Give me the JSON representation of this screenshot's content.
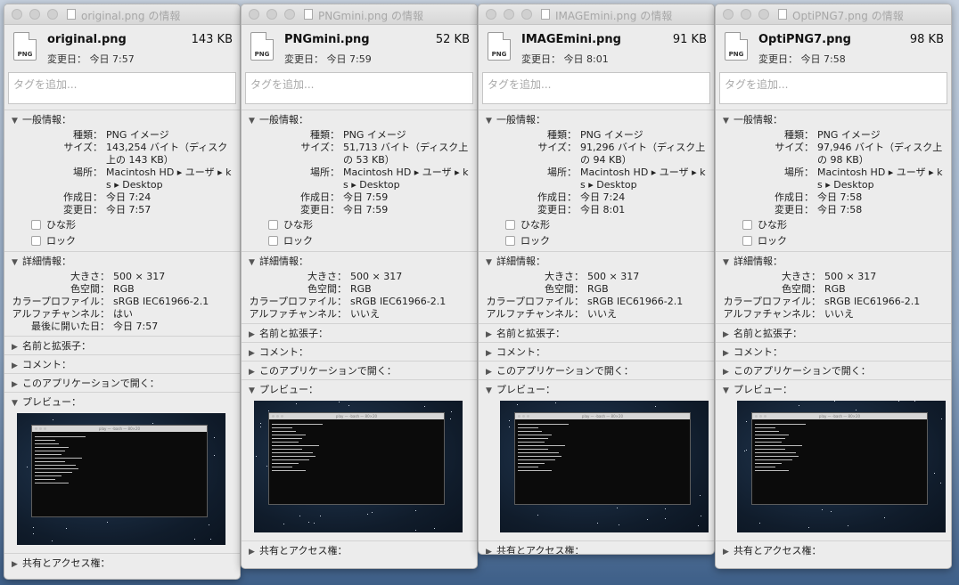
{
  "labels": {
    "tag_placeholder": "タグを追加...",
    "modified_prefix": "変更日：",
    "general": "一般情報：",
    "kind": "種類：",
    "size": "サイズ：",
    "where": "場所：",
    "created": "作成日：",
    "modified": "変更日：",
    "stationery": "ひな形",
    "locked": "ロック",
    "more_info": "詳細情報：",
    "dimensions": "大きさ：",
    "color_space": "色空間：",
    "color_profile": "カラープロファイル：",
    "alpha": "アルファチャンネル：",
    "last_opened": "最後に開いた日：",
    "name_ext": "名前と拡張子：",
    "comments": "コメント：",
    "open_with": "このアプリケーションで開く：",
    "preview": "プレビュー：",
    "sharing": "共有とアクセス権：",
    "icon_text": "PNG",
    "terminal_title": "play — -bash — 80×20"
  },
  "windows": [
    {
      "title": "original.png の情報",
      "name": "original.png",
      "size_short": "143 KB",
      "modified_short": "今日 7:57",
      "kind": "PNG イメージ",
      "size_long": "143,254 バイト（ディスク上の 143 KB）",
      "where": "Macintosh HD ▸ ユーザ ▸ ks ▸ Desktop",
      "created": "今日 7:24",
      "modified": "今日 7:57",
      "dimensions": "500 × 317",
      "color_space": "RGB",
      "color_profile": "sRGB IEC61966-2.1",
      "alpha": "はい",
      "last_opened": "今日 7:57"
    },
    {
      "title": "PNGmini.png の情報",
      "name": "PNGmini.png",
      "size_short": "52 KB",
      "modified_short": "今日 7:59",
      "kind": "PNG イメージ",
      "size_long": "51,713 バイト（ディスク上の 53 KB）",
      "where": "Macintosh HD ▸ ユーザ ▸ ks ▸ Desktop",
      "created": "今日 7:59",
      "modified": "今日 7:59",
      "dimensions": "500 × 317",
      "color_space": "RGB",
      "color_profile": "sRGB IEC61966-2.1",
      "alpha": "いいえ"
    },
    {
      "title": "IMAGEmini.png の情報",
      "name": "IMAGEmini.png",
      "size_short": "91 KB",
      "modified_short": "今日 8:01",
      "kind": "PNG イメージ",
      "size_long": "91,296 バイト（ディスク上の 94 KB）",
      "where": "Macintosh HD ▸ ユーザ ▸ ks ▸ Desktop",
      "created": "今日 7:24",
      "modified": "今日 8:01",
      "dimensions": "500 × 317",
      "color_space": "RGB",
      "color_profile": "sRGB IEC61966-2.1",
      "alpha": "いいえ"
    },
    {
      "title": "OptiPNG7.png の情報",
      "name": "OptiPNG7.png",
      "size_short": "98 KB",
      "modified_short": "今日 7:58",
      "kind": "PNG イメージ",
      "size_long": "97,946 バイト（ディスク上の 98 KB）",
      "where": "Macintosh HD ▸ ユーザ ▸ ks ▸ Desktop",
      "created": "今日 7:58",
      "modified": "今日 7:58",
      "dimensions": "500 × 317",
      "color_space": "RGB",
      "color_profile": "sRGB IEC61966-2.1",
      "alpha": "いいえ"
    }
  ]
}
